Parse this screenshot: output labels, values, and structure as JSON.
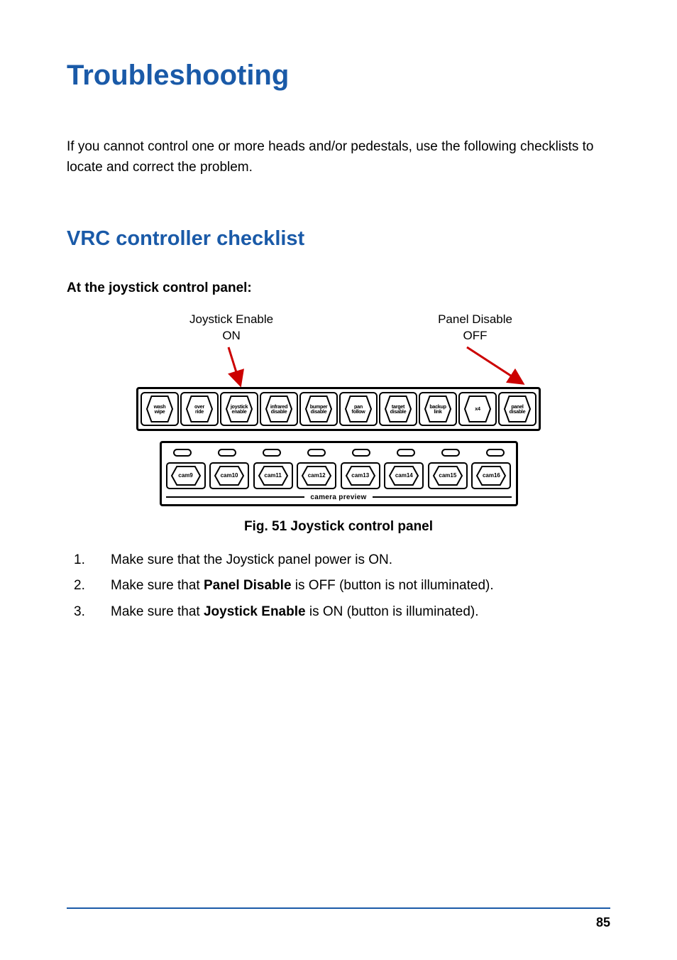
{
  "title": "Troubleshooting",
  "intro": "If you cannot control one or more heads and/or pedestals, use the following checklists to locate and correct the problem.",
  "section": {
    "heading": "VRC controller checklist",
    "subheading": "At the joystick control panel:"
  },
  "figure": {
    "label_left_line1": "Joystick Enable",
    "label_left_line2": "ON",
    "label_right_line1": "Panel Disable",
    "label_right_line2": "OFF",
    "top_buttons": [
      "wash\nwipe",
      "over\nride",
      "joystick\nenable",
      "infrared\ndisable",
      "bumper\ndisable",
      "pan\nfollow",
      "target\ndisable",
      "backup\nlink",
      "x4",
      "panel\ndisable"
    ],
    "cam_buttons": [
      "cam9",
      "cam10",
      "cam11",
      "cam12",
      "cam13",
      "cam14",
      "cam15",
      "cam16"
    ],
    "preview_label": "camera preview",
    "caption": "Fig. 51  Joystick control panel"
  },
  "steps": [
    {
      "n": "1.",
      "pre": "Make sure that the Joystick panel power is ON."
    },
    {
      "n": "2.",
      "pre": "Make sure that ",
      "bold": "Panel Disable",
      "post": " is OFF (button is not illuminated)."
    },
    {
      "n": "3.",
      "pre": "Make sure that ",
      "bold": "Joystick Enable",
      "post": " is ON (button is illuminated)."
    }
  ],
  "page_number": "85"
}
